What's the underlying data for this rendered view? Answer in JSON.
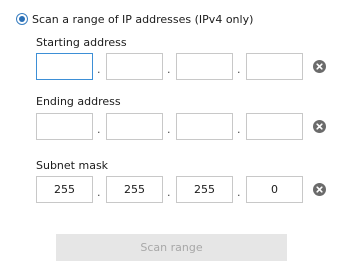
{
  "scan_option": {
    "label": "Scan a range of IP addresses (IPv4 only)",
    "selected": true
  },
  "starting_address": {
    "label": "Starting address",
    "octets": [
      "",
      "",
      "",
      ""
    ]
  },
  "ending_address": {
    "label": "Ending address",
    "octets": [
      "",
      "",
      "",
      ""
    ]
  },
  "subnet_mask": {
    "label": "Subnet mask",
    "octets": [
      "255",
      "255",
      "255",
      "0"
    ]
  },
  "separator": ".",
  "scan_button": {
    "label": "Scan range",
    "enabled": false
  },
  "icons": {
    "radio": "radio-selected-icon",
    "clear": "clear-circle-x-icon"
  },
  "colors": {
    "accent": "#2a6fb6",
    "field_border": "#c8c8c8",
    "focus_border": "#3d8fd6",
    "clear_icon": "#6b6b6b",
    "button_disabled_bg": "#e6e6e6",
    "button_disabled_text": "#a8a8a8"
  }
}
